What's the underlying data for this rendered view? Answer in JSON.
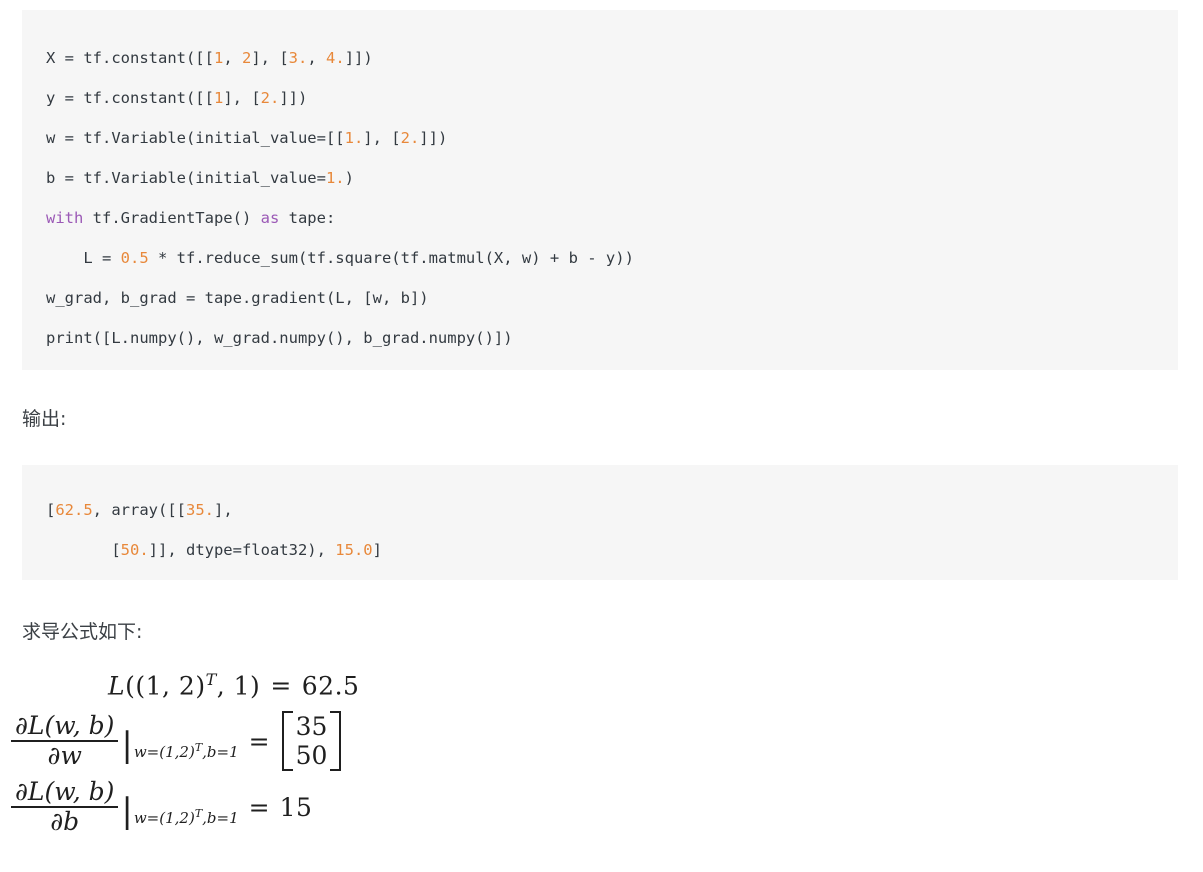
{
  "document": {
    "language": "zh-CN",
    "theme": {
      "page_background": "#ffffff",
      "code_background": "#f6f6f6",
      "text_color": "#2f3337",
      "number_token_color": "#e8883a",
      "keyword_token_color": "#9b59b6",
      "code_plain_color": "#333a41"
    }
  },
  "code_block": {
    "language": "python",
    "lines": [
      {
        "id": "line-1",
        "text": "X = tf.constant([[1, 2], [3., 4.]])",
        "tokens": [
          {
            "t": "X = tf.constant([[",
            "k": "plain"
          },
          {
            "t": "1",
            "k": "num"
          },
          {
            "t": ", ",
            "k": "plain"
          },
          {
            "t": "2",
            "k": "num"
          },
          {
            "t": "], [",
            "k": "plain"
          },
          {
            "t": "3.",
            "k": "num"
          },
          {
            "t": ", ",
            "k": "plain"
          },
          {
            "t": "4.",
            "k": "num"
          },
          {
            "t": "]])",
            "k": "plain"
          }
        ]
      },
      {
        "id": "line-2",
        "text": "y = tf.constant([[1], [2.]])",
        "tokens": [
          {
            "t": "y = tf.constant([[",
            "k": "plain"
          },
          {
            "t": "1",
            "k": "num"
          },
          {
            "t": "], [",
            "k": "plain"
          },
          {
            "t": "2.",
            "k": "num"
          },
          {
            "t": "]])",
            "k": "plain"
          }
        ]
      },
      {
        "id": "line-3",
        "text": "w = tf.Variable(initial_value=[[1.], [2.]])",
        "tokens": [
          {
            "t": "w = tf.Variable(initial_value=[[",
            "k": "plain"
          },
          {
            "t": "1.",
            "k": "num"
          },
          {
            "t": "], [",
            "k": "plain"
          },
          {
            "t": "2.",
            "k": "num"
          },
          {
            "t": "]])",
            "k": "plain"
          }
        ]
      },
      {
        "id": "line-4",
        "text": "b = tf.Variable(initial_value=1.)",
        "tokens": [
          {
            "t": "b = tf.Variable(initial_value=",
            "k": "plain"
          },
          {
            "t": "1.",
            "k": "num"
          },
          {
            "t": ")",
            "k": "plain"
          }
        ]
      },
      {
        "id": "line-5",
        "text": "with tf.GradientTape() as tape:",
        "tokens": [
          {
            "t": "with",
            "k": "kw"
          },
          {
            "t": " tf.GradientTape() ",
            "k": "plain"
          },
          {
            "t": "as",
            "k": "kw"
          },
          {
            "t": " tape:",
            "k": "plain"
          }
        ]
      },
      {
        "id": "line-6",
        "text": "    L = 0.5 * tf.reduce_sum(tf.square(tf.matmul(X, w) + b - y))",
        "tokens": [
          {
            "t": "    L = ",
            "k": "plain"
          },
          {
            "t": "0.5",
            "k": "num"
          },
          {
            "t": " * tf.reduce_sum(tf.square(tf.matmul(X, w) + b - y))",
            "k": "plain"
          }
        ]
      },
      {
        "id": "line-7",
        "text": "w_grad, b_grad = tape.gradient(L, [w, b])",
        "tokens": [
          {
            "t": "w_grad, b_grad = tape.gradient(L, [w, b])",
            "k": "plain"
          }
        ]
      },
      {
        "id": "line-8",
        "text": "print([L.numpy(), w_grad.numpy(), b_grad.numpy()])",
        "tokens": [
          {
            "t": "print([L.numpy(), w_grad.numpy(), b_grad.numpy()])",
            "k": "plain"
          }
        ]
      }
    ]
  },
  "output_label": "输出:",
  "output_block": {
    "lines": [
      {
        "id": "out-line-1",
        "text": "[62.5, array([[35.],",
        "tokens": [
          {
            "t": "[",
            "k": "plain"
          },
          {
            "t": "62.5",
            "k": "num"
          },
          {
            "t": ", array([[",
            "k": "plain"
          },
          {
            "t": "35.",
            "k": "num"
          },
          {
            "t": "],",
            "k": "plain"
          }
        ]
      },
      {
        "id": "out-line-2",
        "text": "       [50.]], dtype=float32), 15.0]",
        "tokens": [
          {
            "t": "       [",
            "k": "plain"
          },
          {
            "t": "50.",
            "k": "num"
          },
          {
            "t": "]], dtype=float32), ",
            "k": "plain"
          },
          {
            "t": "15.0",
            "k": "num"
          },
          {
            "t": "]",
            "k": "plain"
          }
        ]
      }
    ]
  },
  "formula_label": "求导公式如下:",
  "formulas": {
    "loss_value": {
      "latex": "L((1,2)^T, 1) = 62.5",
      "lhs_fn": "L",
      "args": "((1, 2)",
      "transpose": "T",
      "args_tail": ", 1)",
      "equals": "=",
      "value": "62.5"
    },
    "grad_w": {
      "latex": "\\frac{\\partial L(w,b)}{\\partial w}\\big|_{w=(1,2)^T, b=1} = \\begin{bmatrix}35\\\\50\\end{bmatrix}",
      "numerator": "∂L(w, b)",
      "denominator": "∂w",
      "condition_pre": "w=(1,2)",
      "condition_sup": "T",
      "condition_post": ",b=1",
      "equals": "=",
      "matrix": [
        "35",
        "50"
      ]
    },
    "grad_b": {
      "latex": "\\frac{\\partial L(w,b)}{\\partial b}\\big|_{w=(1,2)^T, b=1} = 15",
      "numerator": "∂L(w, b)",
      "denominator": "∂b",
      "condition_pre": "w=(1,2)",
      "condition_sup": "T",
      "condition_post": ",b=1",
      "equals": "=",
      "value": "15"
    }
  }
}
